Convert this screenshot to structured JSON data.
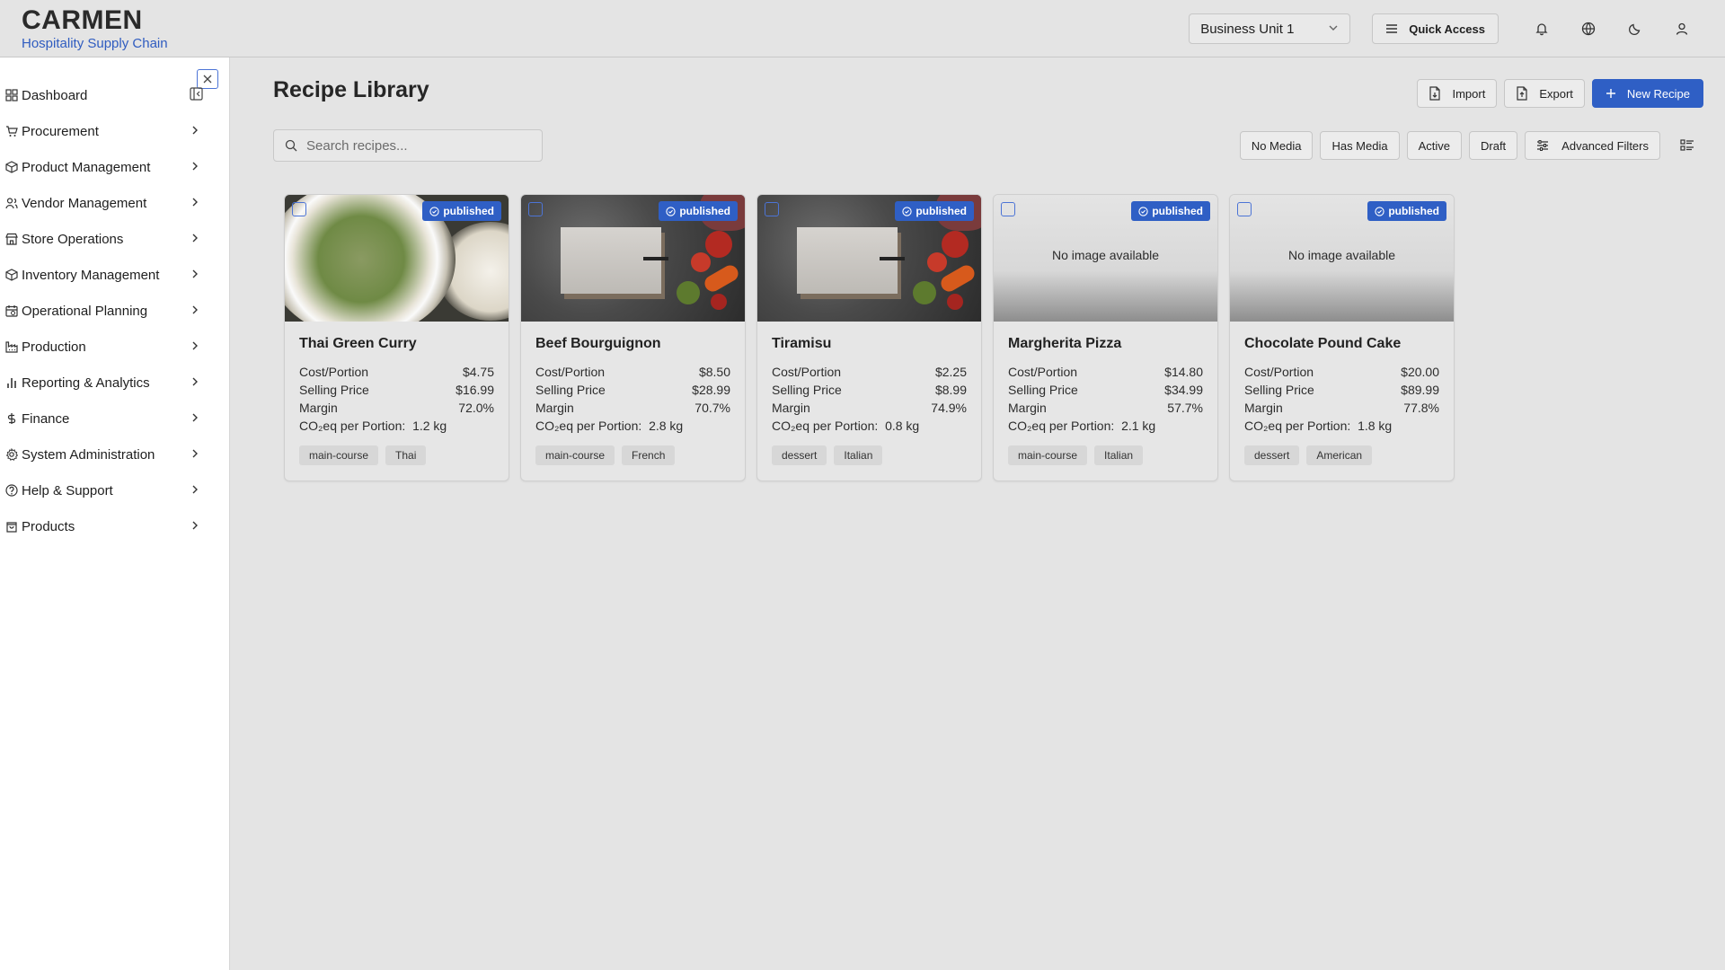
{
  "header": {
    "brand": "CARMEN",
    "subtitle": "Hospitality Supply Chain",
    "business_unit": "Business Unit 1",
    "quick_access": "Quick Access"
  },
  "sidebar": {
    "items": [
      {
        "label": "Dashboard",
        "icon": "grid-icon"
      },
      {
        "label": "Procurement",
        "icon": "cart-icon"
      },
      {
        "label": "Product Management",
        "icon": "package-icon"
      },
      {
        "label": "Vendor Management",
        "icon": "users-icon"
      },
      {
        "label": "Store Operations",
        "icon": "store-icon"
      },
      {
        "label": "Inventory Management",
        "icon": "box-icon"
      },
      {
        "label": "Operational Planning",
        "icon": "calendar-icon"
      },
      {
        "label": "Production",
        "icon": "factory-icon"
      },
      {
        "label": "Reporting & Analytics",
        "icon": "bar-chart-icon"
      },
      {
        "label": "Finance",
        "icon": "dollar-icon"
      },
      {
        "label": "System Administration",
        "icon": "cog-icon"
      },
      {
        "label": "Help & Support",
        "icon": "help-icon"
      },
      {
        "label": "Products",
        "icon": "bag-icon"
      }
    ]
  },
  "main": {
    "title": "Recipe Library",
    "import_label": "Import",
    "export_label": "Export",
    "new_recipe_label": "New Recipe",
    "search_placeholder": "Search recipes...",
    "filters": {
      "no_media": "No Media",
      "has_media": "Has Media",
      "active": "Active",
      "draft": "Draft",
      "advanced": "Advanced Filters"
    }
  },
  "labels": {
    "cost": "Cost/Portion",
    "price": "Selling Price",
    "margin": "Margin",
    "co2": "CO₂eq per Portion:",
    "no_image": "No image available"
  },
  "recipes": [
    {
      "name": "Thai Green Curry",
      "status": "published",
      "cost": "$4.75",
      "price": "$16.99",
      "margin": "72.0%",
      "co2": "1.2 kg",
      "tags": [
        "main-course",
        "Thai"
      ]
    },
    {
      "name": "Beef Bourguignon",
      "status": "published",
      "cost": "$8.50",
      "price": "$28.99",
      "margin": "70.7%",
      "co2": "2.8 kg",
      "tags": [
        "main-course",
        "French"
      ]
    },
    {
      "name": "Tiramisu",
      "status": "published",
      "cost": "$2.25",
      "price": "$8.99",
      "margin": "74.9%",
      "co2": "0.8 kg",
      "tags": [
        "dessert",
        "Italian"
      ]
    },
    {
      "name": "Margherita Pizza",
      "status": "published",
      "cost": "$14.80",
      "price": "$34.99",
      "margin": "57.7%",
      "co2": "2.1 kg",
      "tags": [
        "main-course",
        "Italian"
      ]
    },
    {
      "name": "Chocolate Pound Cake",
      "status": "published",
      "cost": "$20.00",
      "price": "$89.99",
      "margin": "77.8%",
      "co2": "1.8 kg",
      "tags": [
        "dessert",
        "American"
      ]
    }
  ],
  "colors": {
    "accent": "#2f5fc5",
    "brand_subtitle": "#2f5cc0"
  }
}
